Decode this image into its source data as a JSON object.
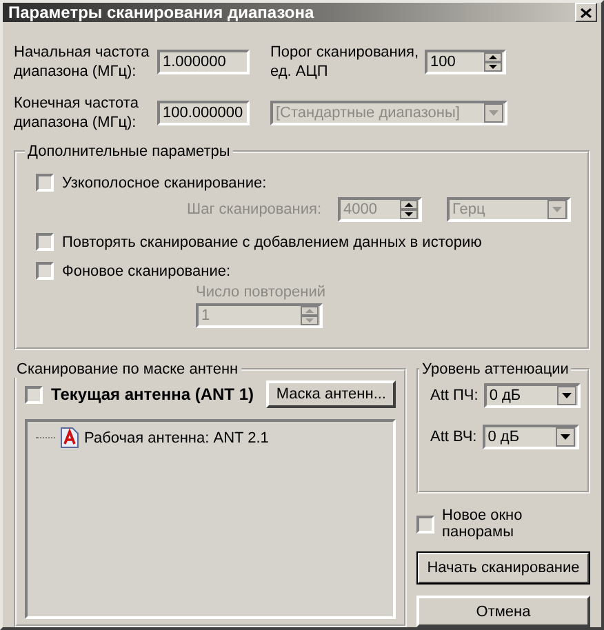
{
  "window": {
    "title": "Параметры сканирования диапазона"
  },
  "range": {
    "start": {
      "label": "Начальная частота диапазона (МГц):",
      "value": "1.000000"
    },
    "end": {
      "label": "Конечная частота диапазона (МГц):",
      "value": "100.000000"
    },
    "threshold": {
      "label": "Порог сканирования, ед. АЦП",
      "value": "100",
      "disabled": false
    },
    "preset": {
      "value": "[Стандартные диапазоны]",
      "disabled": true
    }
  },
  "extra": {
    "title": "Дополнительные параметры",
    "narrowband": {
      "label": "Узкополосное сканирование:",
      "checked": false
    },
    "step": {
      "label": "Шаг сканирования:",
      "value": "4000",
      "disabled": true
    },
    "unit": {
      "value": "Герц",
      "disabled": true
    },
    "repeat": {
      "label": "Повторять сканирование с добавлением данных в историю",
      "checked": false
    },
    "background": {
      "label": "Фоновое сканирование:",
      "checked": false
    },
    "repeats": {
      "label": "Число повторений",
      "value": "1",
      "disabled": true
    }
  },
  "mask": {
    "title": "Сканирование по маске антенн",
    "current": {
      "label": "Текущая антенна (ANT 1)",
      "checked": false
    },
    "button": "Маска антенн...",
    "tree": [
      {
        "label": "Рабочая антенна: ANT 2.1"
      }
    ]
  },
  "attenuation": {
    "title": "Уровень аттенюации",
    "rows": [
      {
        "label": "Att ПЧ:",
        "value": "0 дБ",
        "disabled": false
      },
      {
        "label": "Att ВЧ:",
        "value": "0 дБ",
        "disabled": false
      }
    ]
  },
  "new_window": {
    "label": "Новое окно панорамы",
    "checked": false
  },
  "buttons": [
    {
      "label": "Начать сканирование",
      "default": true
    },
    {
      "label": "Отмена",
      "default": false
    }
  ]
}
